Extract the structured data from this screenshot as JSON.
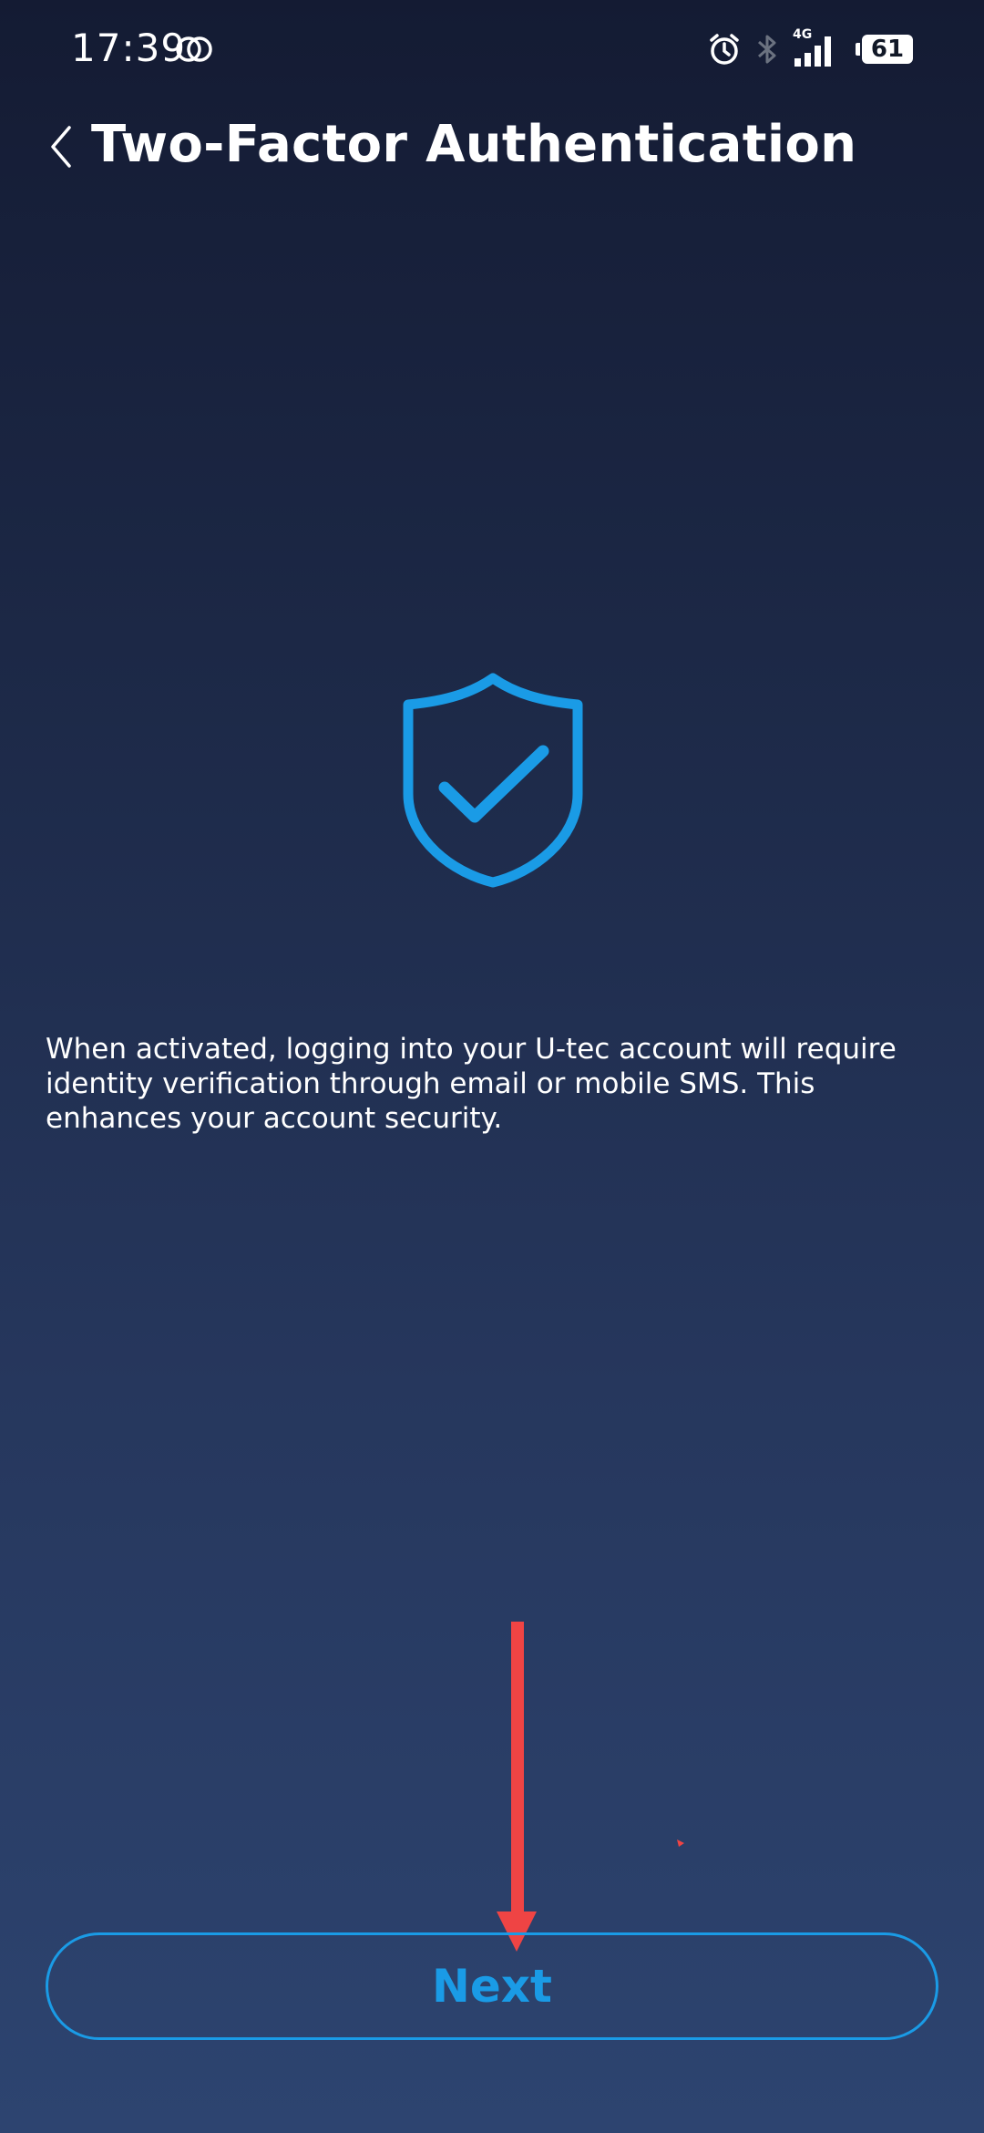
{
  "status_bar": {
    "time": "17:39",
    "battery": "61",
    "network": "4G",
    "icons": [
      "link-icon",
      "alarm-icon",
      "bluetooth-icon",
      "signal-icon",
      "battery-icon"
    ]
  },
  "header": {
    "title": "Two-Factor Authentication",
    "back_icon": "chevron-left-icon"
  },
  "main": {
    "hero_icon": "shield-check-icon",
    "description": "When activated, logging into your U-tec account will require identity verification through email or mobile SMS. This enhances your account security."
  },
  "footer": {
    "next_label": "Next"
  },
  "colors": {
    "accent": "#1a9be6",
    "background_top": "#141b33",
    "background_bottom": "#2d4470",
    "annotation": "#ef4444"
  }
}
